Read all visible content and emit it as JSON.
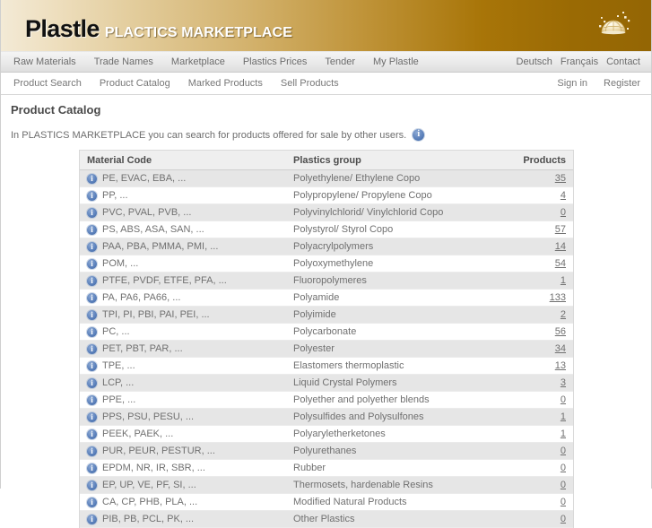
{
  "banner": {
    "logo_main": "Plastle",
    "logo_sub": "PLACTICS MARKETPLACE",
    "globe_icon": "globe-icon"
  },
  "main_nav": {
    "items": [
      {
        "label": "Raw Materials"
      },
      {
        "label": "Trade Names"
      },
      {
        "label": "Marketplace"
      },
      {
        "label": "Plastics Prices"
      },
      {
        "label": "Tender"
      },
      {
        "label": "My Plastle"
      }
    ],
    "right_items": [
      {
        "label": "Deutsch"
      },
      {
        "label": "Français"
      },
      {
        "label": "Contact"
      }
    ]
  },
  "sub_nav": {
    "items": [
      {
        "label": "Product Search"
      },
      {
        "label": "Product Catalog"
      },
      {
        "label": "Marked Products"
      },
      {
        "label": "Sell Products"
      }
    ],
    "right_items": [
      {
        "label": "Sign in"
      },
      {
        "label": "Register"
      }
    ]
  },
  "main": {
    "page_title": "Product Catalog",
    "intro_text": "In PLASTICS MARKETPLACE you can search for products offered for sale by other users.",
    "intro_icon": "info-icon"
  },
  "table": {
    "columns": [
      "Material Code",
      "Plastics group",
      "Products"
    ],
    "rows": [
      {
        "code": "PE, EVAC, EBA, ...",
        "group": "Polyethylene/ Ethylene Copo",
        "products": "35"
      },
      {
        "code": "PP, ...",
        "group": "Polypropylene/ Propylene Copo",
        "products": "4"
      },
      {
        "code": "PVC, PVAL, PVB, ...",
        "group": "Polyvinylchlorid/ Vinylchlorid Copo",
        "products": "0"
      },
      {
        "code": "PS, ABS, ASA, SAN, ...",
        "group": "Polystyrol/ Styrol Copo",
        "products": "57"
      },
      {
        "code": "PAA, PBA, PMMA, PMI, ...",
        "group": "Polyacrylpolymers",
        "products": "14"
      },
      {
        "code": "POM, ...",
        "group": "Polyoxymethylene",
        "products": "54"
      },
      {
        "code": "PTFE, PVDF, ETFE, PFA, ...",
        "group": "Fluoropolymeres",
        "products": "1"
      },
      {
        "code": "PA, PA6, PA66, ...",
        "group": "Polyamide",
        "products": "133"
      },
      {
        "code": "TPI, PI, PBI, PAI, PEI, ...",
        "group": "Polyimide",
        "products": "2"
      },
      {
        "code": "PC, ...",
        "group": "Polycarbonate",
        "products": "56"
      },
      {
        "code": "PET, PBT, PAR, ...",
        "group": "Polyester",
        "products": "34"
      },
      {
        "code": "TPE, ...",
        "group": "Elastomers thermoplastic",
        "products": "13"
      },
      {
        "code": "LCP, ...",
        "group": "Liquid Crystal Polymers",
        "products": "3"
      },
      {
        "code": "PPE, ...",
        "group": "Polyether and polyether blends",
        "products": "0"
      },
      {
        "code": "PPS, PSU, PESU, ...",
        "group": "Polysulfides and Polysulfones",
        "products": "1"
      },
      {
        "code": "PEEK, PAEK, ...",
        "group": "Polyaryletherketones",
        "products": "1"
      },
      {
        "code": "PUR, PEUR, PESTUR, ...",
        "group": "Polyurethanes",
        "products": "0"
      },
      {
        "code": "EPDM, NR, IR, SBR, ...",
        "group": "Rubber",
        "products": "0"
      },
      {
        "code": "EP, UP, VE, PF, SI, ...",
        "group": "Thermosets, hardenable Resins",
        "products": "0"
      },
      {
        "code": "CA, CP, PHB, PLA, ...",
        "group": "Modified Natural Products",
        "products": "0"
      },
      {
        "code": "PIB, PB, PCL, PK, ...",
        "group": "Other Plastics",
        "products": "0"
      }
    ],
    "row_icon": "info-icon"
  },
  "colors": {
    "banner_start": "#f3ead6",
    "banner_end": "#946604",
    "info_icon_blue": "#4f74b2",
    "row_alt": "#e6e6e6",
    "header_bg": "#efefef",
    "text": "#707070"
  }
}
